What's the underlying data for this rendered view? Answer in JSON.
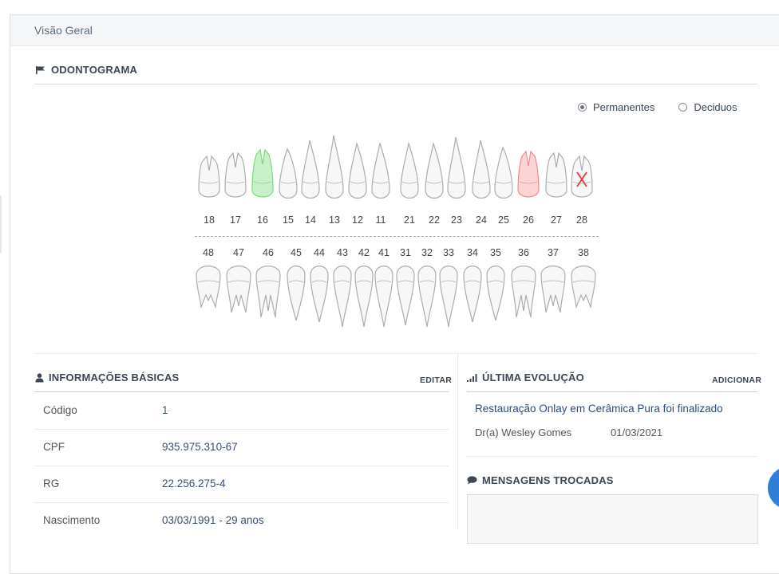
{
  "panel": {
    "title": "Visão Geral"
  },
  "odontograma": {
    "title": "ODONTOGRAMA",
    "options": [
      {
        "label": "Permanentes",
        "selected": true
      },
      {
        "label": "Deciduos",
        "selected": false
      }
    ],
    "upper_numbers": [
      "18",
      "17",
      "16",
      "15",
      "14",
      "13",
      "12",
      "11",
      "21",
      "22",
      "23",
      "24",
      "25",
      "26",
      "27",
      "28"
    ],
    "lower_numbers": [
      "48",
      "47",
      "46",
      "45",
      "44",
      "43",
      "42",
      "41",
      "31",
      "32",
      "33",
      "34",
      "35",
      "36",
      "37",
      "38"
    ],
    "highlights": {
      "16": "#7fd67f",
      "26": "#f08a8a",
      "28": "missing"
    }
  },
  "info": {
    "title": "INFORMAÇÕES BÁSICAS",
    "edit_label": "EDITAR",
    "rows": [
      {
        "label": "Código",
        "value": "1"
      },
      {
        "label": "CPF",
        "value": "935.975.310-67"
      },
      {
        "label": "RG",
        "value": "22.256.275-4"
      },
      {
        "label": "Nascimento",
        "value": "03/03/1991 - 29 anos"
      }
    ]
  },
  "evolution": {
    "title": "ÚLTIMA EVOLUÇÃO",
    "add_label": "ADICIONAR",
    "text": "Restauração Onlay em Cerâmica Pura foi finalizado",
    "doctor": "Dr(a) Wesley Gomes",
    "date": "01/03/2021"
  },
  "messages": {
    "title": "MENSAGENS TROCADAS"
  }
}
